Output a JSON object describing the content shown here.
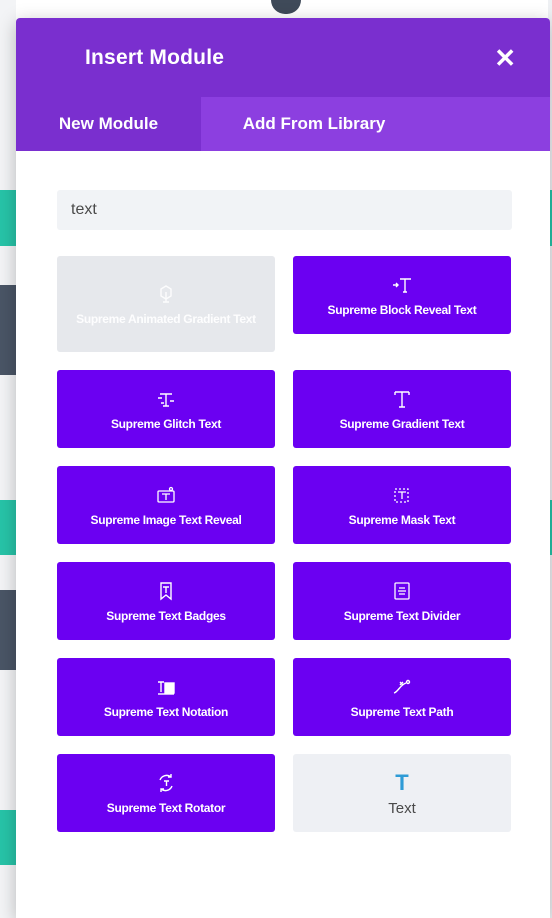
{
  "modal": {
    "title": "Insert Module",
    "close_icon": "close-icon",
    "tabs": [
      {
        "label": "New Module",
        "active": true
      },
      {
        "label": "Add From Library",
        "active": false
      }
    ],
    "search": {
      "value": "text",
      "placeholder": ""
    }
  },
  "modules": [
    {
      "label": "Supreme Animated Gradient Text",
      "icon": "animated-gradient-icon",
      "state": "disabled"
    },
    {
      "label": "Supreme Block Reveal Text",
      "icon": "block-reveal-icon",
      "state": "enabled"
    },
    {
      "label": "Supreme Glitch Text",
      "icon": "glitch-text-icon",
      "state": "enabled"
    },
    {
      "label": "Supreme Gradient Text",
      "icon": "gradient-text-icon",
      "state": "enabled"
    },
    {
      "label": "Supreme Image Text Reveal",
      "icon": "image-text-reveal-icon",
      "state": "enabled"
    },
    {
      "label": "Supreme Mask Text",
      "icon": "mask-text-icon",
      "state": "enabled"
    },
    {
      "label": "Supreme Text Badges",
      "icon": "text-badges-icon",
      "state": "enabled"
    },
    {
      "label": "Supreme Text Divider",
      "icon": "text-divider-icon",
      "state": "enabled"
    },
    {
      "label": "Supreme Text Notation",
      "icon": "text-notation-icon",
      "state": "enabled"
    },
    {
      "label": "Supreme Text Path",
      "icon": "text-path-icon",
      "state": "enabled"
    },
    {
      "label": "Supreme Text Rotator",
      "icon": "text-rotator-icon",
      "state": "enabled"
    },
    {
      "label": "Text",
      "icon": "text-icon",
      "state": "plain",
      "glyph": "T"
    }
  ],
  "colors": {
    "header": "#7a2fcf",
    "tabs": "#8c3fe0",
    "module": "#6b00f2",
    "disabled": "#e6e8ec",
    "text_icon": "#2e9bd6"
  }
}
